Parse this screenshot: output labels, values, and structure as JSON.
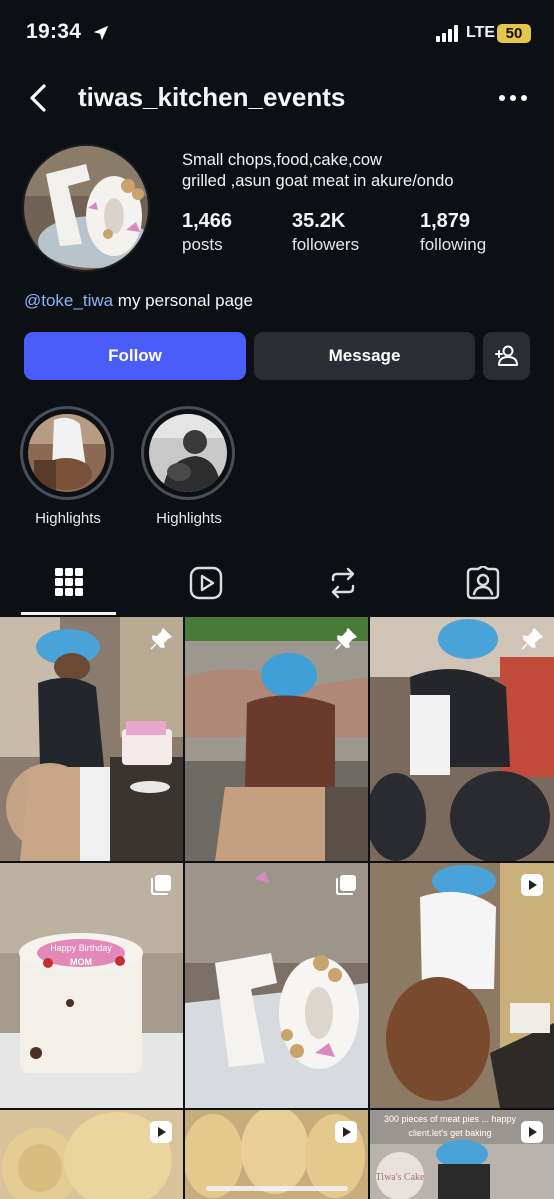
{
  "status": {
    "time": "19:34",
    "network": "LTE",
    "battery": "50"
  },
  "header": {
    "username": "tiwas_kitchen_events"
  },
  "profile": {
    "bio_line1": "Small chops,food,cake,cow",
    "bio_line2": "grilled ,asun goat meat in akure/ondo",
    "posts_count": "1,466",
    "posts_label": "posts",
    "followers_count": "35.2K",
    "followers_label": "followers",
    "following_count": "1,879",
    "following_label": "following",
    "mention": "@toke_tiwa",
    "mention_suffix": " my personal page"
  },
  "actions": {
    "follow": "Follow",
    "message": "Message"
  },
  "highlights": [
    {
      "label": "Highlights"
    },
    {
      "label": "Highlights"
    }
  ],
  "tabs": [
    "grid-icon",
    "reels-icon",
    "reposts-icon",
    "tagged-icon"
  ],
  "posts": [
    {
      "type": "pinned"
    },
    {
      "type": "pinned"
    },
    {
      "type": "pinned"
    },
    {
      "type": "carousel",
      "caption": "Happy Birthday MOM"
    },
    {
      "type": "carousel"
    },
    {
      "type": "reel"
    },
    {
      "type": "reel"
    },
    {
      "type": "reel"
    },
    {
      "type": "reel",
      "caption": "300 pieces of meat pies ... happy client.let's get baking"
    }
  ],
  "colors": {
    "accent": "#4a5df9",
    "background": "#0c0f14",
    "mention": "#8ab4f8"
  }
}
